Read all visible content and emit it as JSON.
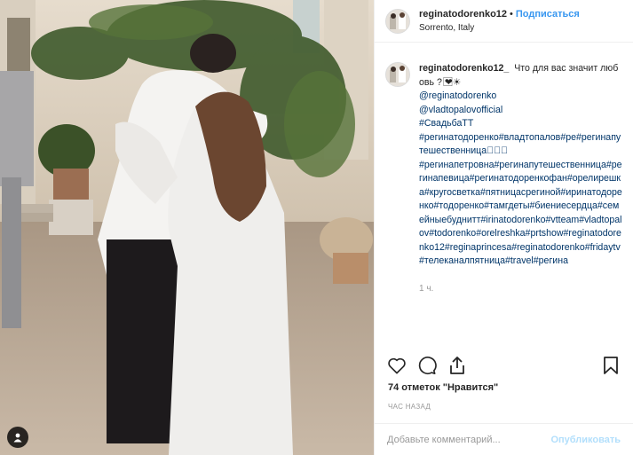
{
  "post": {
    "username": "reginatodorenko12",
    "dot": "•",
    "follow_label": "Подписаться",
    "location": "Sorrento, Italy"
  },
  "caption": {
    "username": "reginatodorenko12_",
    "lines": [
      "Что для вас значит любовь ? ❤︎⃞☀",
      "@reginatodorenko",
      "@vladtopalovofficial",
      "#СвадьбаТТ",
      "#регинатодоренко#владтопалов#ре#регинапутешественница⃞⃞⃞",
      "#регинапетровна#регинапутешественница#регинапевица#регинатодоренкофан#орелирешка#кругосветка#пятницасрегиной#иринатодоренко#тодоренко#тамгдеты#биениесердца#семейныебуднитт#irinatodorenko#vtteam#vladtopalov#todorenko#orelreshka#prtshow#reginatodorenko12#reginaprincesa#reginatodorenko#fridaytv#телеканалпятница#travel#регина"
    ],
    "time_ago": "1 ч."
  },
  "actions": {
    "like_icon": "heart-icon",
    "comment_icon": "comment-icon",
    "share_icon": "share-icon",
    "save_icon": "bookmark-icon"
  },
  "likes_text": "74 отметок \"Нравится\"",
  "date_text": "час назад",
  "comment": {
    "placeholder": "Добавьте комментарий...",
    "publish_label": "Опубликовать"
  },
  "colors": {
    "link": "#3897f0",
    "publish_disabled": "#b2dffc",
    "muted": "#999999",
    "text": "#262626"
  }
}
